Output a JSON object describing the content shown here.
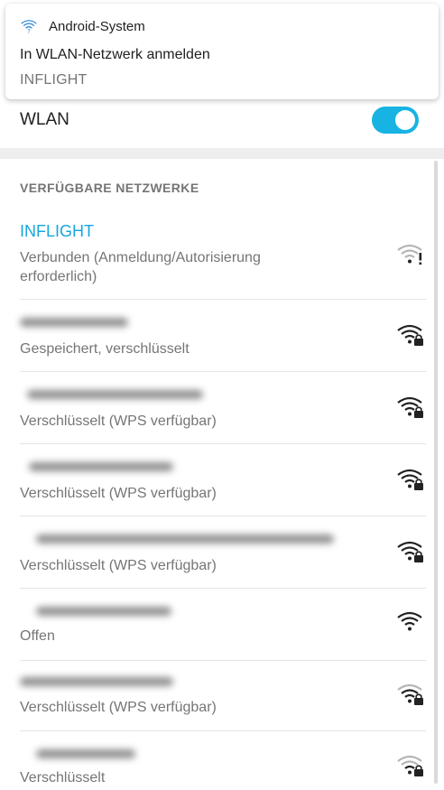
{
  "notification": {
    "app_name": "Android-System",
    "title": "In WLAN-Netzwerk anmelden",
    "text": "INFLIGHT"
  },
  "wlan": {
    "label": "WLAN",
    "enabled": true
  },
  "section_title": "VERFÜGBARE NETZWERKE",
  "networks": [
    {
      "name": "INFLIGHT",
      "status": "Verbunden (Anmeldung/Autorisierung erforderlich)",
      "icon": "wifi-exclamation-icon"
    },
    {
      "name": "",
      "status": "Gespeichert, verschlüsselt",
      "icon": "wifi-lock-icon"
    },
    {
      "name": "",
      "status": "Verschlüsselt (WPS verfügbar)",
      "icon": "wifi-lock-icon"
    },
    {
      "name": "",
      "status": "Verschlüsselt (WPS verfügbar)",
      "icon": "wifi-lock-icon"
    },
    {
      "name": "",
      "status": "Verschlüsselt (WPS verfügbar)",
      "icon": "wifi-lock-icon"
    },
    {
      "name": "",
      "status": "Offen",
      "icon": "wifi-icon"
    },
    {
      "name": "",
      "status": "Verschlüsselt (WPS verfügbar)",
      "icon": "wifi-lock-weak-icon"
    },
    {
      "name": "",
      "status": "Verschlüsselt",
      "icon": "wifi-lock-weak-icon"
    }
  ],
  "colors": {
    "accent": "#17b3e3",
    "connected_name": "#17a6dc",
    "secondary_text": "#757575"
  }
}
